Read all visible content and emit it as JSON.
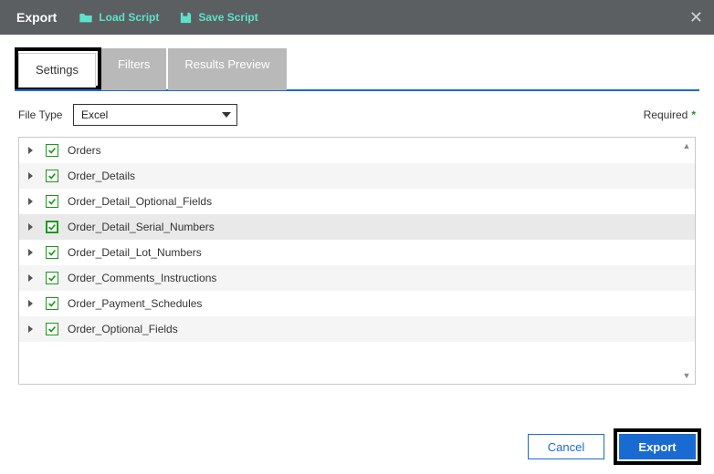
{
  "header": {
    "title": "Export",
    "load_script": "Load Script",
    "save_script": "Save Script"
  },
  "tabs": {
    "settings": "Settings",
    "filters": "Filters",
    "results_preview": "Results Preview"
  },
  "form": {
    "file_type_label": "File Type",
    "file_type_value": "Excel",
    "required_label": "Required"
  },
  "tree": {
    "items": [
      {
        "label": "Orders"
      },
      {
        "label": "Order_Details"
      },
      {
        "label": "Order_Detail_Optional_Fields"
      },
      {
        "label": "Order_Detail_Serial_Numbers"
      },
      {
        "label": "Order_Detail_Lot_Numbers"
      },
      {
        "label": "Order_Comments_Instructions"
      },
      {
        "label": "Order_Payment_Schedules"
      },
      {
        "label": "Order_Optional_Fields"
      }
    ]
  },
  "footer": {
    "cancel": "Cancel",
    "export": "Export"
  }
}
